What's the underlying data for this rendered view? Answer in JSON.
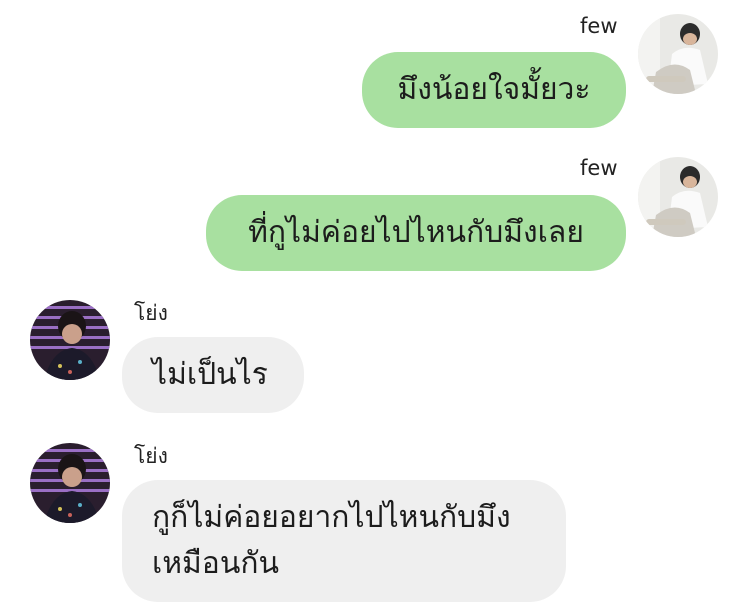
{
  "colors": {
    "outgoing_bubble": "#a8e0a0",
    "incoming_bubble": "#efefef",
    "background": "#ffffff"
  },
  "messages": [
    {
      "direction": "outgoing",
      "sender": "few",
      "text": "มึงน้อยใจมั้ยวะ",
      "avatar_icon": "avatar-few-icon"
    },
    {
      "direction": "outgoing",
      "sender": "few",
      "text": "ที่กูไม่ค่อยไปไหนกับมึงเลย",
      "avatar_icon": "avatar-few-icon"
    },
    {
      "direction": "incoming",
      "sender": "โย่ง",
      "text": "ไม่เป็นไร",
      "avatar_icon": "avatar-yong-icon"
    },
    {
      "direction": "incoming",
      "sender": "โย่ง",
      "lines": [
        "กูก็ไม่ค่อยอยากไปไหนกับมึง",
        "เหมือนกัน"
      ],
      "avatar_icon": "avatar-yong-icon"
    }
  ]
}
